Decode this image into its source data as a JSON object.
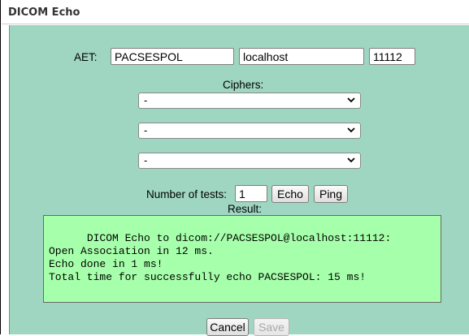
{
  "window": {
    "title": "DICOM Echo"
  },
  "form": {
    "aet_label": "AET:",
    "aet_value": "PACSESPOL",
    "host_value": "localhost",
    "port_value": "11112",
    "ciphers_label": "Ciphers:",
    "ciphers": [
      {
        "selected": "-"
      },
      {
        "selected": "-"
      },
      {
        "selected": "-"
      }
    ],
    "num_tests_label": "Number of tests:",
    "num_tests_value": "1",
    "echo_button": "Echo",
    "ping_button": "Ping",
    "result_label": "Result:",
    "result_text": "DICOM Echo to dicom://PACSESPOL@localhost:11112:\nOpen Association in 12 ms.\nEcho done in 1 ms!\nTotal time for successfully echo PACSESPOL: 15 ms!"
  },
  "footer": {
    "cancel_button": "Cancel",
    "save_button": "Save"
  },
  "colors": {
    "panel_background": "#9fd6c1",
    "result_background": "#a6ffaa"
  },
  "icons": [
    "chevron-down-icon",
    "resize-grip-icon"
  ]
}
